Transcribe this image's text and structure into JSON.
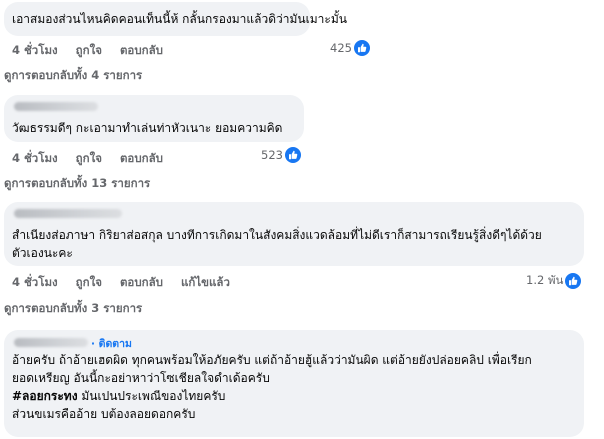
{
  "comments": [
    {
      "text": "เอาสมองส่วนไหนคิดคอนเท็นนี้ห้ กลั้นกรองมาแล้วดิว่ามันเมาะมั้น",
      "time": "4 ชั่วโมง",
      "like": "ถูกใจ",
      "reply": "ตอบกลับ",
      "reaction_count": "425",
      "view_replies": "ดูการตอบกลับทั้ง 4 รายการ"
    },
    {
      "text": "วัฒธรรมดีๆ กะเอามาทำเล่นท่าหัวเนาะ ยอมความคิด",
      "time": "4 ชั่วโมง",
      "like": "ถูกใจ",
      "reply": "ตอบกลับ",
      "reaction_count": "523",
      "view_replies": "ดูการตอบกลับทั้ง 13 รายการ"
    },
    {
      "text_line1": "สำเนียงส่อภาษา กิริยาส่อสกุล บางทีการเกิดมาในสังคมสิ่งแวดล้อมที่ไม่ดีเราก็สามารถเรียนรู้สิ่งดีๆได้ด้วย",
      "text_line2": "ตัวเองนะคะ",
      "time": "4 ชั่วโมง",
      "like": "ถูกใจ",
      "reply": "ตอบกลับ",
      "edited": "แก้ไขแล้ว",
      "reaction_count": "1.2 พัน",
      "view_replies": "ดูการตอบกลับทั้ง 3 รายการ"
    },
    {
      "follow": "· ติดตาม",
      "line1": "อ้ายครับ ถ้าอ้ายเฮดผิด ทุกคนพร้อมให้อภัยครับ แต่ถ้าอ้ายฮู้แล้วว่ามันผิด แต่อ้ายยังปล่อยคลิป เพื่อเรียก",
      "line2": "ยอดเหรียญ อันนี้กะอย่าหาว่าโซเชียลใจดำเด้อครับ",
      "hashtag": "#ลอยกระทง",
      "line3_rest": " มันเปนประเพณีของไทยครับ",
      "line4": "ส่วนขเมรคืออ้าย บต้องลอยดอกครับ"
    }
  ],
  "colors": {
    "bubble": "#f0f2f5",
    "meta": "#65676b",
    "accent": "#1877f2"
  }
}
